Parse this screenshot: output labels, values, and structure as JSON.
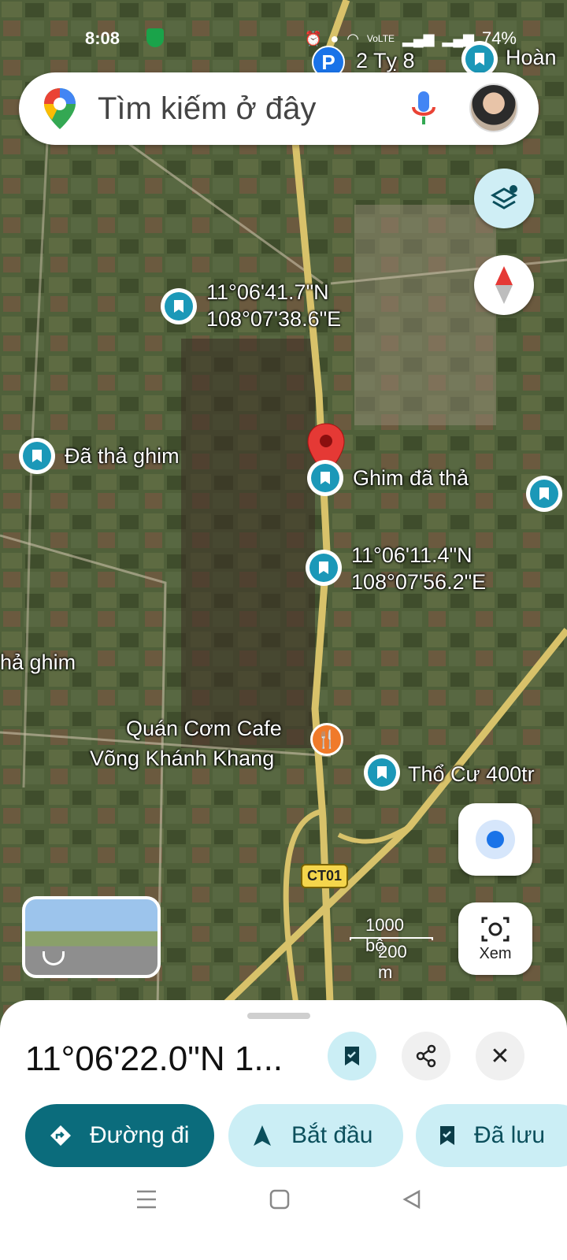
{
  "status_bar": {
    "time": "8:08",
    "battery": "74%",
    "network": "VoLTE"
  },
  "search": {
    "placeholder": "Tìm kiếm ở đây"
  },
  "map": {
    "top_labels": {
      "parking": "P",
      "poi1": "2 Tỵ 8",
      "poi2": "Hoàn"
    },
    "pins": [
      {
        "lat": "11°06'41.7\"N",
        "lng": "108°07'38.6\"E"
      },
      {
        "label": "Đã thả ghim"
      },
      {
        "label": "Ghim đã thả"
      },
      {
        "lat": "11°06'11.4\"N",
        "lng": "108°07'56.2\"E"
      },
      {
        "label": "hả ghim"
      },
      {
        "label": "Thổ Cư 400tr"
      }
    ],
    "restaurant": {
      "line1": "Quán Cơm Cafe",
      "line2": "Võng Khánh Khang"
    },
    "road_badge": "CT01",
    "scale": {
      "feet": "1000 bộ",
      "meters": "200 m"
    },
    "explore_label": "Xem"
  },
  "sheet": {
    "coords": "11°06'22.0\"N 1...",
    "buttons": {
      "directions": "Đường đi",
      "start": "Bắt đầu",
      "saved": "Đã lưu"
    }
  },
  "colors": {
    "accent": "#0b6c7c",
    "chip": "#cbeef5",
    "marker": "#1b98b8",
    "pin": "#e53935"
  }
}
